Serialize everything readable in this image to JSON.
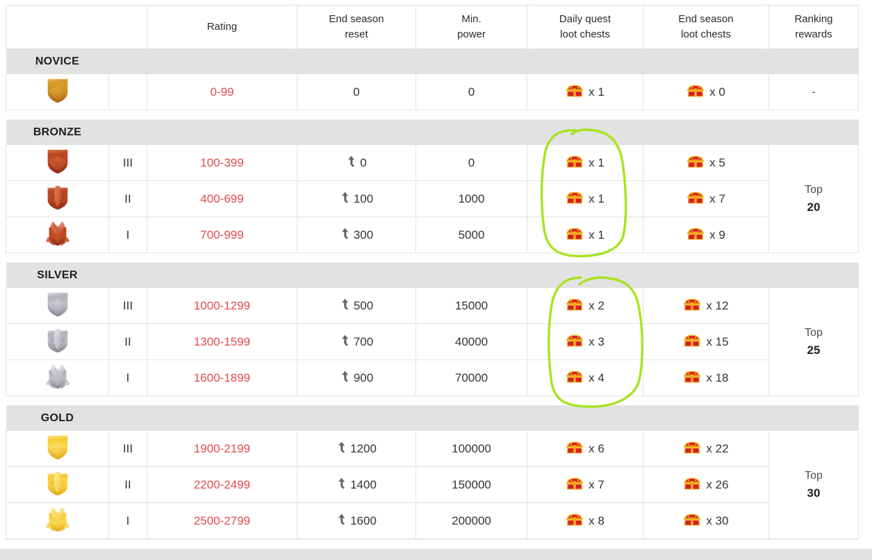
{
  "table": {
    "columns": [
      {
        "key": "badge",
        "label": ""
      },
      {
        "key": "division",
        "label": ""
      },
      {
        "key": "rating",
        "label": "Rating"
      },
      {
        "key": "reset",
        "label_line1": "End season",
        "label_line2": "reset"
      },
      {
        "key": "power",
        "label_line1": "Min.",
        "label_line2": "power"
      },
      {
        "key": "daily",
        "label_line1": "Daily quest",
        "label_line2": "loot chests"
      },
      {
        "key": "season",
        "label_line1": "End season",
        "label_line2": "loot chests"
      },
      {
        "key": "ranking",
        "label_line1": "Ranking",
        "label_line2": "rewards"
      }
    ],
    "tiers": [
      {
        "name": "NOVICE",
        "badge_color": "gold-brown",
        "ranking_reward": {
          "top_label": "",
          "value": "-"
        },
        "rows": [
          {
            "division": "",
            "rating": "0-99",
            "reset": "0",
            "reset_has_icon": false,
            "power": "0",
            "daily_chests": "x 1",
            "season_chests": "x 0"
          }
        ]
      },
      {
        "name": "BRONZE",
        "badge_color": "bronze",
        "ranking_reward": {
          "top_label": "Top",
          "value": "20"
        },
        "rows": [
          {
            "division": "III",
            "rating": "100-399",
            "reset": "0",
            "reset_has_icon": true,
            "power": "0",
            "daily_chests": "x 1",
            "season_chests": "x 5"
          },
          {
            "division": "II",
            "rating": "400-699",
            "reset": "100",
            "reset_has_icon": true,
            "power": "1000",
            "daily_chests": "x 1",
            "season_chests": "x 7"
          },
          {
            "division": "I",
            "rating": "700-999",
            "reset": "300",
            "reset_has_icon": true,
            "power": "5000",
            "daily_chests": "x 1",
            "season_chests": "x 9"
          }
        ]
      },
      {
        "name": "SILVER",
        "badge_color": "silver",
        "ranking_reward": {
          "top_label": "Top",
          "value": "25"
        },
        "rows": [
          {
            "division": "III",
            "rating": "1000-1299",
            "reset": "500",
            "reset_has_icon": true,
            "power": "15000",
            "daily_chests": "x 2",
            "season_chests": "x 12"
          },
          {
            "division": "II",
            "rating": "1300-1599",
            "reset": "700",
            "reset_has_icon": true,
            "power": "40000",
            "daily_chests": "x 3",
            "season_chests": "x 15"
          },
          {
            "division": "I",
            "rating": "1600-1899",
            "reset": "900",
            "reset_has_icon": true,
            "power": "70000",
            "daily_chests": "x 4",
            "season_chests": "x 18"
          }
        ]
      },
      {
        "name": "GOLD",
        "badge_color": "gold",
        "ranking_reward": {
          "top_label": "Top",
          "value": "30"
        },
        "rows": [
          {
            "division": "III",
            "rating": "1900-2199",
            "reset": "1200",
            "reset_has_icon": true,
            "power": "100000",
            "daily_chests": "x 6",
            "season_chests": "x 22"
          },
          {
            "division": "II",
            "rating": "2200-2499",
            "reset": "1400",
            "reset_has_icon": true,
            "power": "150000",
            "daily_chests": "x 7",
            "season_chests": "x 26"
          },
          {
            "division": "I",
            "rating": "2500-2799",
            "reset": "1600",
            "reset_has_icon": true,
            "power": "200000",
            "daily_chests": "x 8",
            "season_chests": "x 30"
          }
        ]
      }
    ]
  },
  "icons": {
    "chest": "treasure-chest-icon",
    "reset_arrow": "curved-up-arrow-icon"
  },
  "annotations": {
    "color": "#a8e31e",
    "shapes": [
      {
        "name": "bronze-daily-chests-circle",
        "target": "Daily quest loot chests - BRONZE rows"
      },
      {
        "name": "silver-daily-chests-circle",
        "target": "Daily quest loot chests - SILVER rows"
      }
    ]
  },
  "colors": {
    "rating_text": "#e24a4a",
    "tier_banner_bg": "#e2e2e2",
    "border": "#e2e2e4",
    "annotation_green": "#a8e31e"
  }
}
